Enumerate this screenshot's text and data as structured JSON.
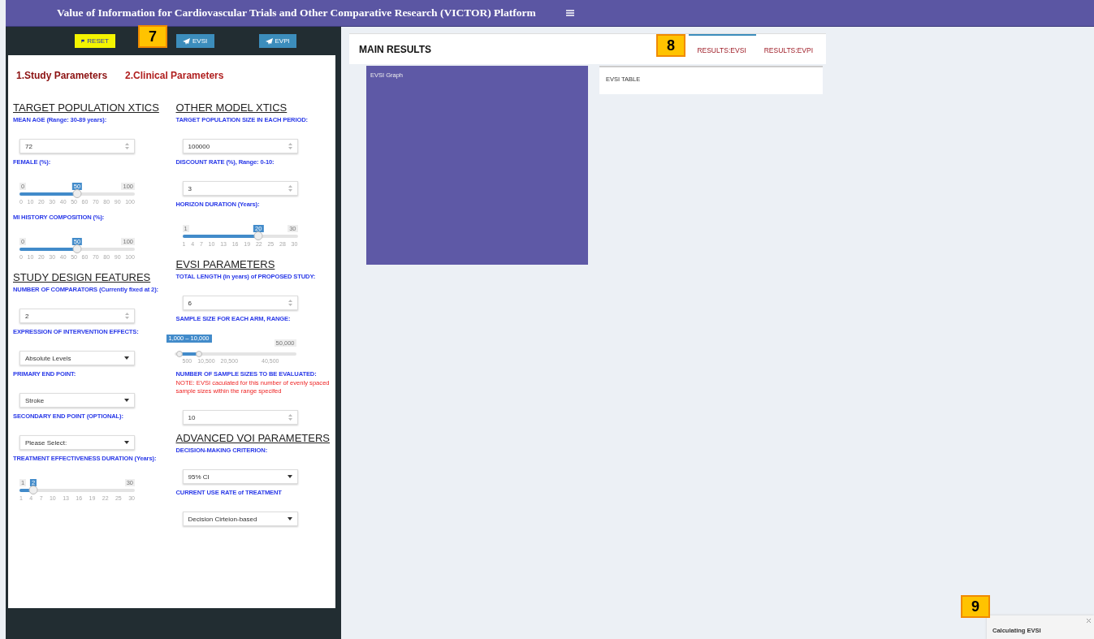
{
  "header": {
    "title": "Value of Information for Cardiovascular Trials and Other Comparative Research (VICTOR) Platform"
  },
  "sidebar": {
    "buttons": [
      {
        "kind": "reset",
        "label": "RESET"
      },
      {
        "kind": "send",
        "label": "EVSI"
      },
      {
        "kind": "send",
        "label": "EVPI"
      }
    ],
    "tabs": [
      {
        "label": "1.Study Parameters",
        "selected": true
      },
      {
        "label": "2.Clinical Parameters",
        "selected": false
      }
    ],
    "columns": [
      {
        "items": [
          {
            "kind": "heading",
            "text": "TARGET POPULATION XTICS"
          },
          {
            "kind": "label",
            "text": "MEAN AGE (Range: 30-89 years):"
          },
          {
            "kind": "number",
            "value": "72"
          },
          {
            "kind": "label",
            "text": "FEMALE (%):"
          },
          {
            "kind": "slider",
            "min": "0",
            "max": "100",
            "value": "50",
            "level": 0.5,
            "ticks": [
              "0",
              "10",
              "20",
              "30",
              "40",
              "50",
              "60",
              "70",
              "80",
              "90",
              "100"
            ]
          },
          {
            "kind": "label",
            "text": "MI HISTORY COMPOSITION (%):"
          },
          {
            "kind": "slider",
            "min": "0",
            "max": "100",
            "value": "50",
            "level": 0.5,
            "ticks": [
              "0",
              "10",
              "20",
              "30",
              "40",
              "50",
              "60",
              "70",
              "80",
              "90",
              "100"
            ]
          },
          {
            "kind": "heading",
            "text": "STUDY DESIGN FEATURES"
          },
          {
            "kind": "label",
            "text": "NUMBER OF COMPARATORS (Currently fixed at 2):"
          },
          {
            "kind": "number",
            "value": "2"
          },
          {
            "kind": "label",
            "text": "EXPRESSION OF INTERVENTION EFFECTS:"
          },
          {
            "kind": "select",
            "value": "Absolute Levels"
          },
          {
            "kind": "label",
            "text": "PRIMARY END POINT:"
          },
          {
            "kind": "select",
            "value": "Stroke"
          },
          {
            "kind": "label",
            "text": "SECONDARY END POINT (OPTIONAL):"
          },
          {
            "kind": "select",
            "value": "Please Select:"
          },
          {
            "kind": "label",
            "text": "TREATMENT EFFECTIVENESS DURATION (Years):"
          },
          {
            "kind": "slider",
            "min": "1",
            "max": "30",
            "value": "2",
            "level": 0.12,
            "ticks": [
              "1",
              "4",
              "7",
              "10",
              "13",
              "16",
              "19",
              "22",
              "25",
              "30"
            ]
          }
        ]
      },
      {
        "items": [
          {
            "kind": "heading",
            "text": "OTHER MODEL XTICS"
          },
          {
            "kind": "label",
            "text": "TARGET POPULATION SIZE IN EACH PERIOD:"
          },
          {
            "kind": "number",
            "value": "100000"
          },
          {
            "kind": "label",
            "text": "DISCOUNT RATE (%), Range: 0-10:"
          },
          {
            "kind": "number",
            "value": "3"
          },
          {
            "kind": "label",
            "text": "HORIZON DURATION (Years):"
          },
          {
            "kind": "slider",
            "min": "1",
            "max": "30",
            "value": "20",
            "level": 0.66,
            "ticks": [
              "1",
              "4",
              "7",
              "10",
              "13",
              "16",
              "19",
              "22",
              "25",
              "28",
              "30"
            ]
          },
          {
            "kind": "heading",
            "text": "EVSI PARAMETERS"
          },
          {
            "kind": "label",
            "text": "TOTAL LENGTH (in years) of PROPOSED STUDY:"
          },
          {
            "kind": "number",
            "value": "6"
          },
          {
            "kind": "label",
            "text": "SAMPLE SIZE FOR EACH ARM, RANGE:"
          },
          {
            "kind": "range",
            "value": "1,000 – 10,000",
            "max": "50,000",
            "thumbs": [
              {
                "level": 0.04
              },
              {
                "level": 0.2
              }
            ],
            "ticks": [
              "500",
              "10,500",
              "20,500",
              "40,500"
            ]
          },
          {
            "kind": "label",
            "text": "NUMBER OF SAMPLE SIZES TO BE EVALUATED:"
          },
          {
            "kind": "note",
            "text": "NOTE: EVSI caculated for this number of evenly spaced sample sizes within the range specifed"
          },
          {
            "kind": "number",
            "value": "10"
          },
          {
            "kind": "heading",
            "text": "ADVANCED VOI PARAMETERS"
          },
          {
            "kind": "label",
            "text": "DECISION-MAKING CRITERION:"
          },
          {
            "kind": "select",
            "value": "95% CI"
          },
          {
            "kind": "label",
            "text": "CURRENT USE RATE of TREATMENT"
          },
          {
            "kind": "select",
            "value": "Decision Cirteion-based"
          }
        ]
      }
    ]
  },
  "main": {
    "title": "MAIN RESULTS",
    "tabs": [
      {
        "label": "RESULTS:EVSI",
        "selected": true
      },
      {
        "label": "RESULTS:EVPI",
        "selected": false
      }
    ],
    "graph": {
      "title": "EVSI Graph"
    },
    "table": {
      "title": "EVSI TABLE"
    }
  },
  "notification": {
    "text": "Calculating EVSI"
  },
  "callouts": [
    {
      "label": "7"
    },
    {
      "label": "8"
    },
    {
      "label": "9"
    }
  ]
}
